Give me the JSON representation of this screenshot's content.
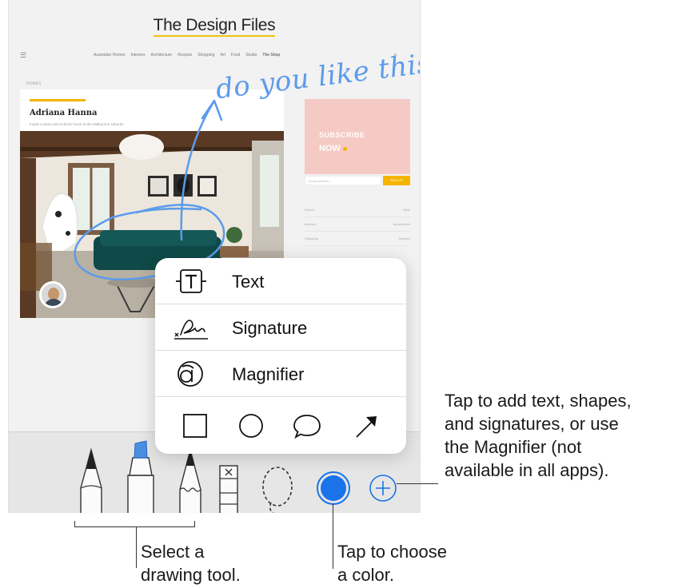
{
  "site": {
    "title": "The Design Files",
    "nav_items": [
      "Australian Homes",
      "Interiors",
      "Architecture",
      "Recipes",
      "Shopping",
      "Art",
      "Food",
      "Studio",
      "The Shop"
    ],
    "breadcrumb": "HOMES"
  },
  "article": {
    "author": "Adriana Hanna",
    "subtitle": "Inside a warm and eclectic home in the Melbourne suburbs"
  },
  "annotation": {
    "handwriting": "do you like this ?"
  },
  "ad": {
    "title": "SUBSCRIBE",
    "cta": "NOW",
    "input_placeholder": "Email address",
    "button_label": "SIGN UP",
    "list": [
      [
        "Homes",
        "Style"
      ],
      [
        "Interiors",
        "Architecture"
      ],
      [
        "Shopping",
        "Recipes"
      ]
    ]
  },
  "popup_menu": {
    "items": [
      {
        "label": "Text",
        "icon": "text-box-icon"
      },
      {
        "label": "Signature",
        "icon": "signature-icon"
      },
      {
        "label": "Magnifier",
        "icon": "magnifier-icon"
      }
    ],
    "shapes": [
      "square-icon",
      "circle-icon",
      "speech-bubble-icon",
      "arrow-icon"
    ]
  },
  "toolbar": {
    "tools": [
      "pen-icon",
      "marker-icon",
      "pencil-icon",
      "eraser-icon",
      "lasso-icon"
    ],
    "selected_color": "#1a73e8",
    "add_button_icon": "plus-icon"
  },
  "callouts": {
    "add": "Tap to add text, shapes,\nand signatures, or use\nthe Magnifier (not\navailable in all apps).",
    "tool": "Select a\ndrawing tool.",
    "color": "Tap to choose\na color."
  },
  "colors": {
    "accent_blue": "#1a73e8",
    "ink_blue": "#5b9bea",
    "brand_yellow": "#f5b400",
    "ad_pink": "#f5c9c4"
  }
}
